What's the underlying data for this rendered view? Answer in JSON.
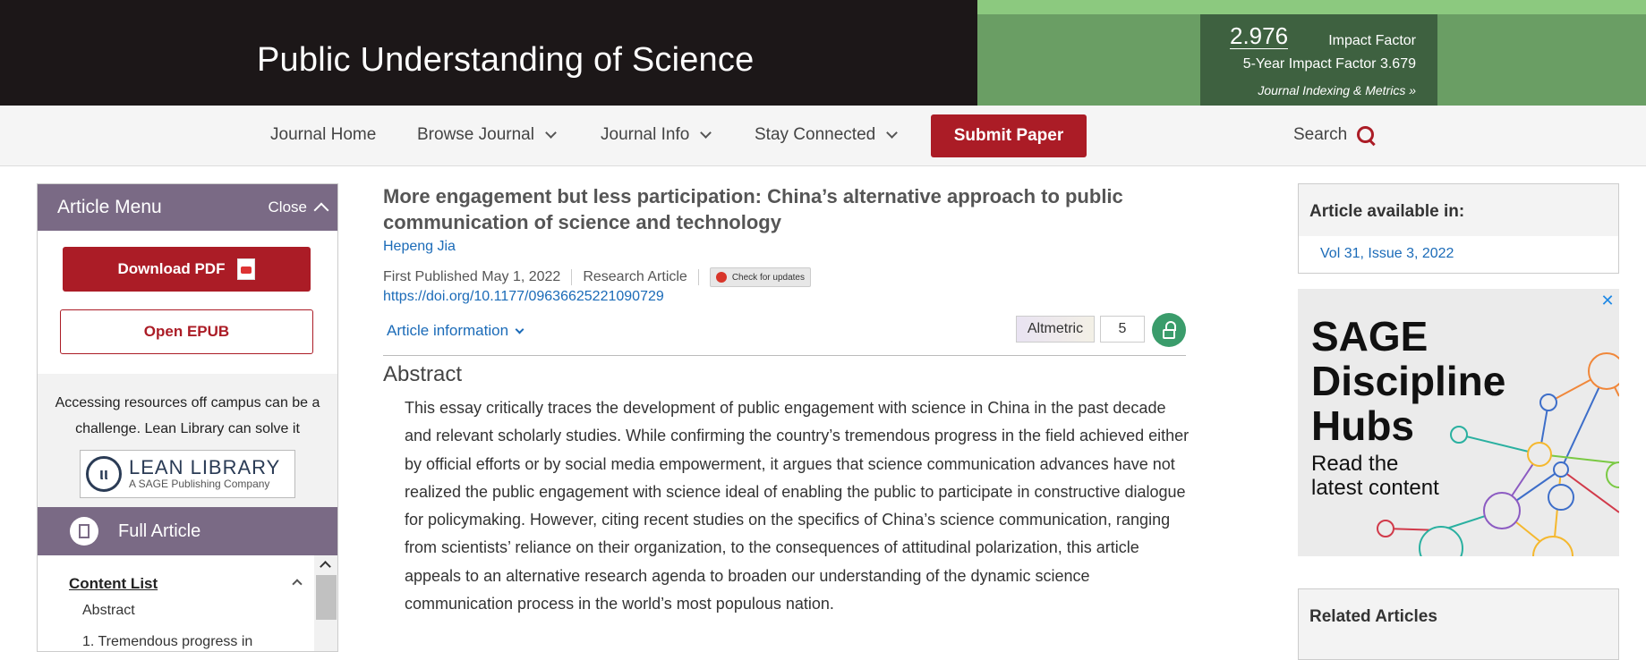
{
  "header": {
    "journal_title": "Public Understanding of Science",
    "impact_factor_value": "2.976",
    "impact_factor_label": "Impact Factor",
    "five_year_if": "5-Year Impact Factor 3.679",
    "metrics_link": "Journal Indexing & Metrics »"
  },
  "nav": {
    "items": [
      "Journal Home",
      "Browse Journal",
      "Journal Info",
      "Stay Connected"
    ],
    "submit": "Submit Paper",
    "search": "Search"
  },
  "menu": {
    "title": "Article Menu",
    "close": "Close",
    "download_pdf": "Download PDF",
    "open_epub": "Open EPUB",
    "lean_text": "Accessing resources off campus can be a challenge. Lean Library can solve it",
    "lean_logo_main": "LEAN LIBRARY",
    "lean_logo_sub": "A SAGE Publishing Company",
    "lean_logo_mark": "ιι",
    "full_article": "Full Article",
    "content_list_title": "Content List",
    "content_list": [
      "Abstract",
      "1. Tremendous progress in"
    ]
  },
  "article": {
    "title": "More engagement but less participation: China’s alternative approach to public communication of science and technology",
    "author": "Hepeng Jia",
    "first_published": "First Published May 1, 2022",
    "type": "Research Article",
    "check_updates": "Check for updates",
    "doi": "https://doi.org/10.1177/09636625221090729",
    "article_info": "Article information",
    "altmetric_label": "Altmetric",
    "altmetric_score": "5",
    "abstract_heading": "Abstract",
    "abstract_text": "This essay critically traces the development of public engagement with science in China in the past decade and relevant scholarly studies. While confirming the country’s tremendous progress in the field achieved either by official efforts or by social media empowerment, it argues that science communication advances have not realized the public engagement with science ideal of enabling the public to participate in constructive dialogue for policymaking. However, citing recent studies on the specifics of China’s science communication, ranging from scientists’ reliance on their organization, to the consequences of attitudinal polarization, this article appeals to an alternative research agenda to broaden our understanding of the dynamic science communication process in the world’s most populous nation."
  },
  "sidebar": {
    "available_heading": "Article available in:",
    "issue_link": "Vol 31, Issue 3, 2022",
    "ad_heading_lines": [
      "SAGE",
      "Discipline",
      "Hubs"
    ],
    "ad_sub_lines": [
      "Read the",
      "latest content"
    ],
    "ad_close": "✕",
    "related_heading": "Related Articles"
  },
  "colors": {
    "header_dark": "#1c1718",
    "header_green": "#6a9e64",
    "metrics_green": "#3e6140",
    "brand_red": "#ab1c26",
    "menu_purple": "#7a6a85",
    "link_blue": "#1b6bb8",
    "open_access_green": "#3a9c6b"
  }
}
